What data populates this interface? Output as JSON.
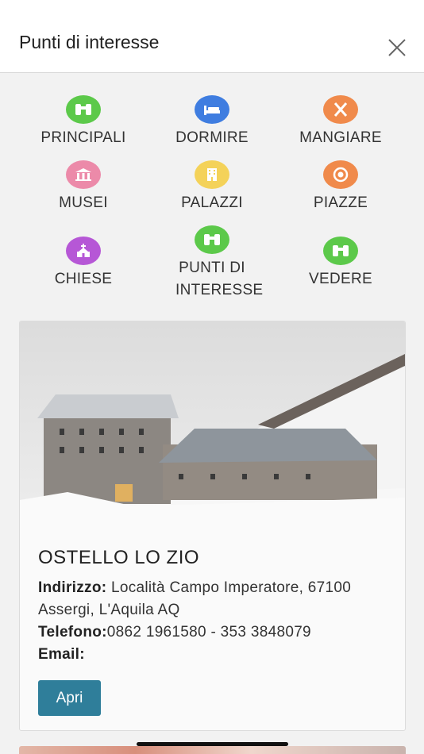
{
  "header": {
    "title": "Punti di interesse"
  },
  "categories": [
    {
      "label": "PRINCIPALI",
      "icon": "binoculars-icon",
      "color": "#5cc94a"
    },
    {
      "label": "DORMIRE",
      "icon": "bed-icon",
      "color": "#3f7de0"
    },
    {
      "label": "MANGIARE",
      "icon": "utensils-icon",
      "color": "#f08a4b"
    },
    {
      "label": "MUSEI",
      "icon": "museum-icon",
      "color": "#ec8aa9"
    },
    {
      "label": "PALAZZI",
      "icon": "building-icon",
      "color": "#f4d259"
    },
    {
      "label": "PIAZZE",
      "icon": "target-icon",
      "color": "#f08a4b"
    },
    {
      "label": "CHIESE",
      "icon": "church-icon",
      "color": "#b657d6"
    },
    {
      "label": "PUNTI DI INTERESSE",
      "icon": "binoculars-icon",
      "color": "#5cc94a"
    },
    {
      "label": "VEDERE",
      "icon": "binoculars-icon",
      "color": "#5cc94a"
    }
  ],
  "card": {
    "title": "OSTELLO LO ZIO",
    "address_label": "Indirizzo:",
    "address_value": "Località Campo Imperatore, 67100 Assergi, L'Aquila AQ",
    "phone_label": "Telefono:",
    "phone_value": "0862 1961580 - 353 3848079",
    "email_label": "Email:",
    "email_value": "",
    "open_label": "Apri"
  }
}
